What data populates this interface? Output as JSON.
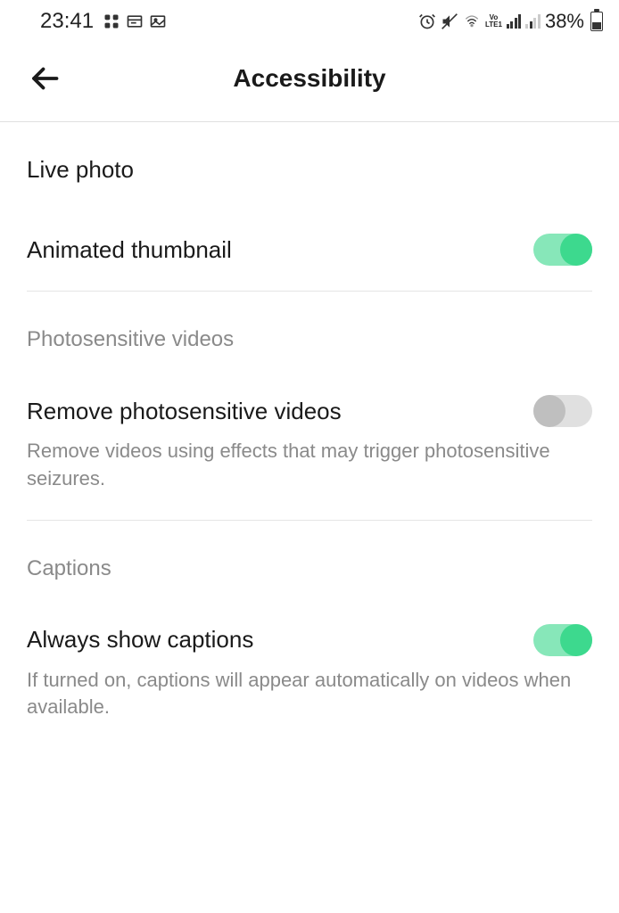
{
  "status_bar": {
    "time": "23:41",
    "battery": "38%",
    "lte": "LTE1",
    "vo": "Vo"
  },
  "header": {
    "title": "Accessibility"
  },
  "settings": {
    "live_photo": {
      "label": "Live photo"
    },
    "animated_thumbnail": {
      "label": "Animated thumbnail",
      "enabled": true
    },
    "photosensitive": {
      "section": "Photosensitive videos",
      "label": "Remove photosensitive videos",
      "description": "Remove videos using effects that may trigger photosensitive seizures.",
      "enabled": false
    },
    "captions": {
      "section": "Captions",
      "label": "Always show captions",
      "description": "If turned on, captions will appear automatically on videos when available.",
      "enabled": true
    }
  }
}
